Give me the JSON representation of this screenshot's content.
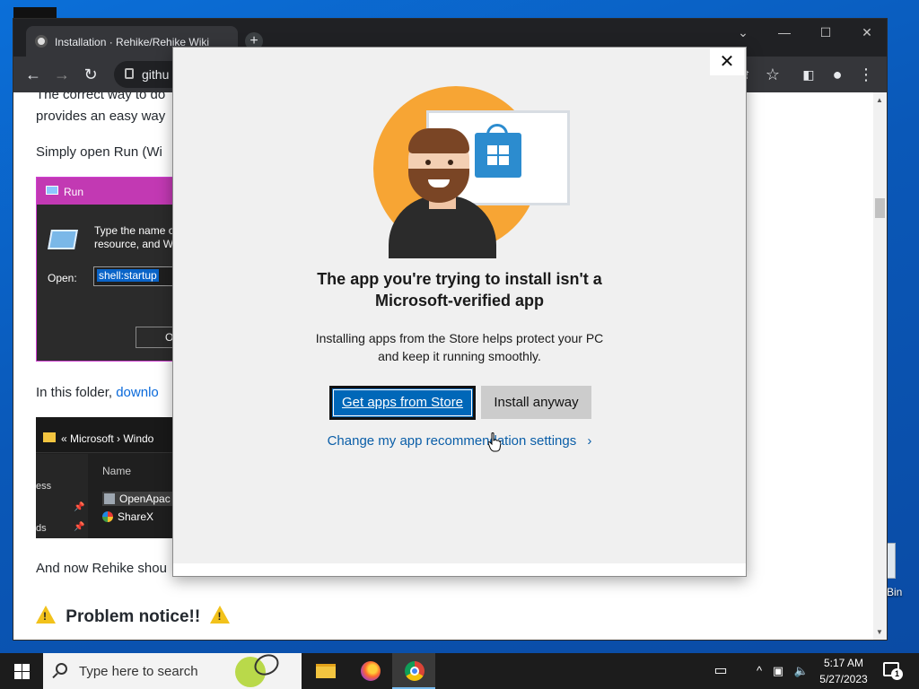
{
  "desktop": {
    "recycle_label": "Bin"
  },
  "browser": {
    "tab_title": "Installation · Rehike/Rehike Wiki",
    "new_tab": "+",
    "url": "githu",
    "controls": {
      "dropdown": "⌄",
      "minimize": "—",
      "maximize": "☐",
      "close": "✕"
    }
  },
  "page": {
    "p1_line1": "The correct way to do",
    "p1_line2": "provides an easy way",
    "p2": "Simply open Run (Wi",
    "run_dialog": {
      "title": "Run",
      "desc_line1": "Type the name o",
      "desc_line2": "resource, and Wi",
      "open_label": "Open:",
      "open_value": "shell:startup",
      "ok_label": "O"
    },
    "p3_prefix": "In this folder, ",
    "p3_link": "downlo",
    "explorer": {
      "breadcrumb": "«  Microsoft  ›  Windo",
      "side_item1": "ess",
      "side_item2": "ds",
      "col_name": "Name",
      "row1": "OpenApac",
      "row2": "ShareX"
    },
    "p4": "And now Rehike shou",
    "heading": "Problem notice!!"
  },
  "dialog": {
    "close": "✕",
    "title_line1": "The app you're trying to install isn't a",
    "title_line2": "Microsoft-verified app",
    "body_line1": "Installing apps from the Store helps protect your PC",
    "body_line2": "and keep it running smoothly.",
    "primary_button": "Get apps from Store",
    "secondary_button": "Install anyway",
    "settings_link": "Change my app recommendation settings",
    "settings_chevron": "›"
  },
  "taskbar": {
    "search_placeholder": "Type here to search",
    "time": "5:17 AM",
    "date": "5/27/2023",
    "notification_count": "1"
  }
}
